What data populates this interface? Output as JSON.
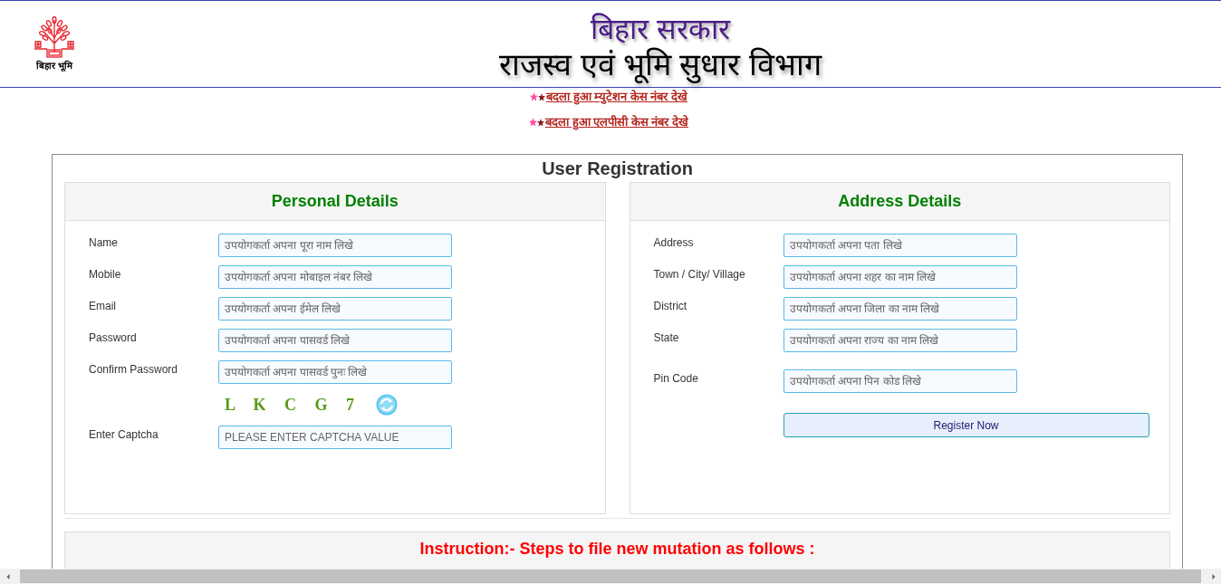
{
  "header": {
    "logo_caption": "बिहार भूमि",
    "title": "बिहार सरकार",
    "subtitle": "राजस्व एवं भूमि सुधार विभाग"
  },
  "links": [
    "बदला हुआ म्युटेशन केस नंबर देखे",
    "बदला हुआ एलपीसी केस नंबर देखे"
  ],
  "registration": {
    "title": "User Registration",
    "personal_details": {
      "title": "Personal Details",
      "fields": [
        {
          "kind": "input",
          "label": "Name",
          "placeholder": "उपयोगकर्ता अपना पूरा नाम लिखे"
        },
        {
          "kind": "input",
          "label": "Mobile",
          "placeholder": "उपयोगकर्ता अपना मोबाइल नंबर लिखे"
        },
        {
          "kind": "input",
          "label": "Email",
          "placeholder": "उपयोगकर्ता अपना ईमेल लिखे"
        },
        {
          "kind": "input",
          "label": "Password",
          "placeholder": "उपयोगकर्ता अपना पासवर्ड लिखे"
        },
        {
          "kind": "input",
          "label": "Confirm Password",
          "placeholder": "उपयोगकर्ता अपना पासवर्ड पुनः लिखे"
        },
        {
          "kind": "captcha",
          "text": "L K C G 7"
        },
        {
          "kind": "input",
          "label": "Enter Captcha",
          "placeholder": "PLEASE ENTER CAPTCHA VALUE"
        }
      ]
    },
    "address_details": {
      "title": "Address Details",
      "fields": [
        {
          "kind": "input",
          "label": "Address",
          "placeholder": "उपयोगकर्ता अपना पता लिखे"
        },
        {
          "kind": "input",
          "label": "Town / City/ Village",
          "placeholder": "उपयोगकर्ता अपना शहर का नाम लिखे"
        },
        {
          "kind": "input",
          "label": "District",
          "placeholder": "उपयोगकर्ता अपना जिला का नाम लिखे"
        },
        {
          "kind": "input",
          "label": "State",
          "placeholder": "उपयोगकर्ता अपना राज्य का नाम लिखे"
        },
        {
          "kind": "input",
          "label": "Pin Code",
          "placeholder": "उपयोगकर्ता अपना पिन कोड लिखे"
        }
      ],
      "button": "Register Now"
    }
  },
  "instruction": {
    "title": "Instruction:- Steps to file new mutation as follows :"
  }
}
